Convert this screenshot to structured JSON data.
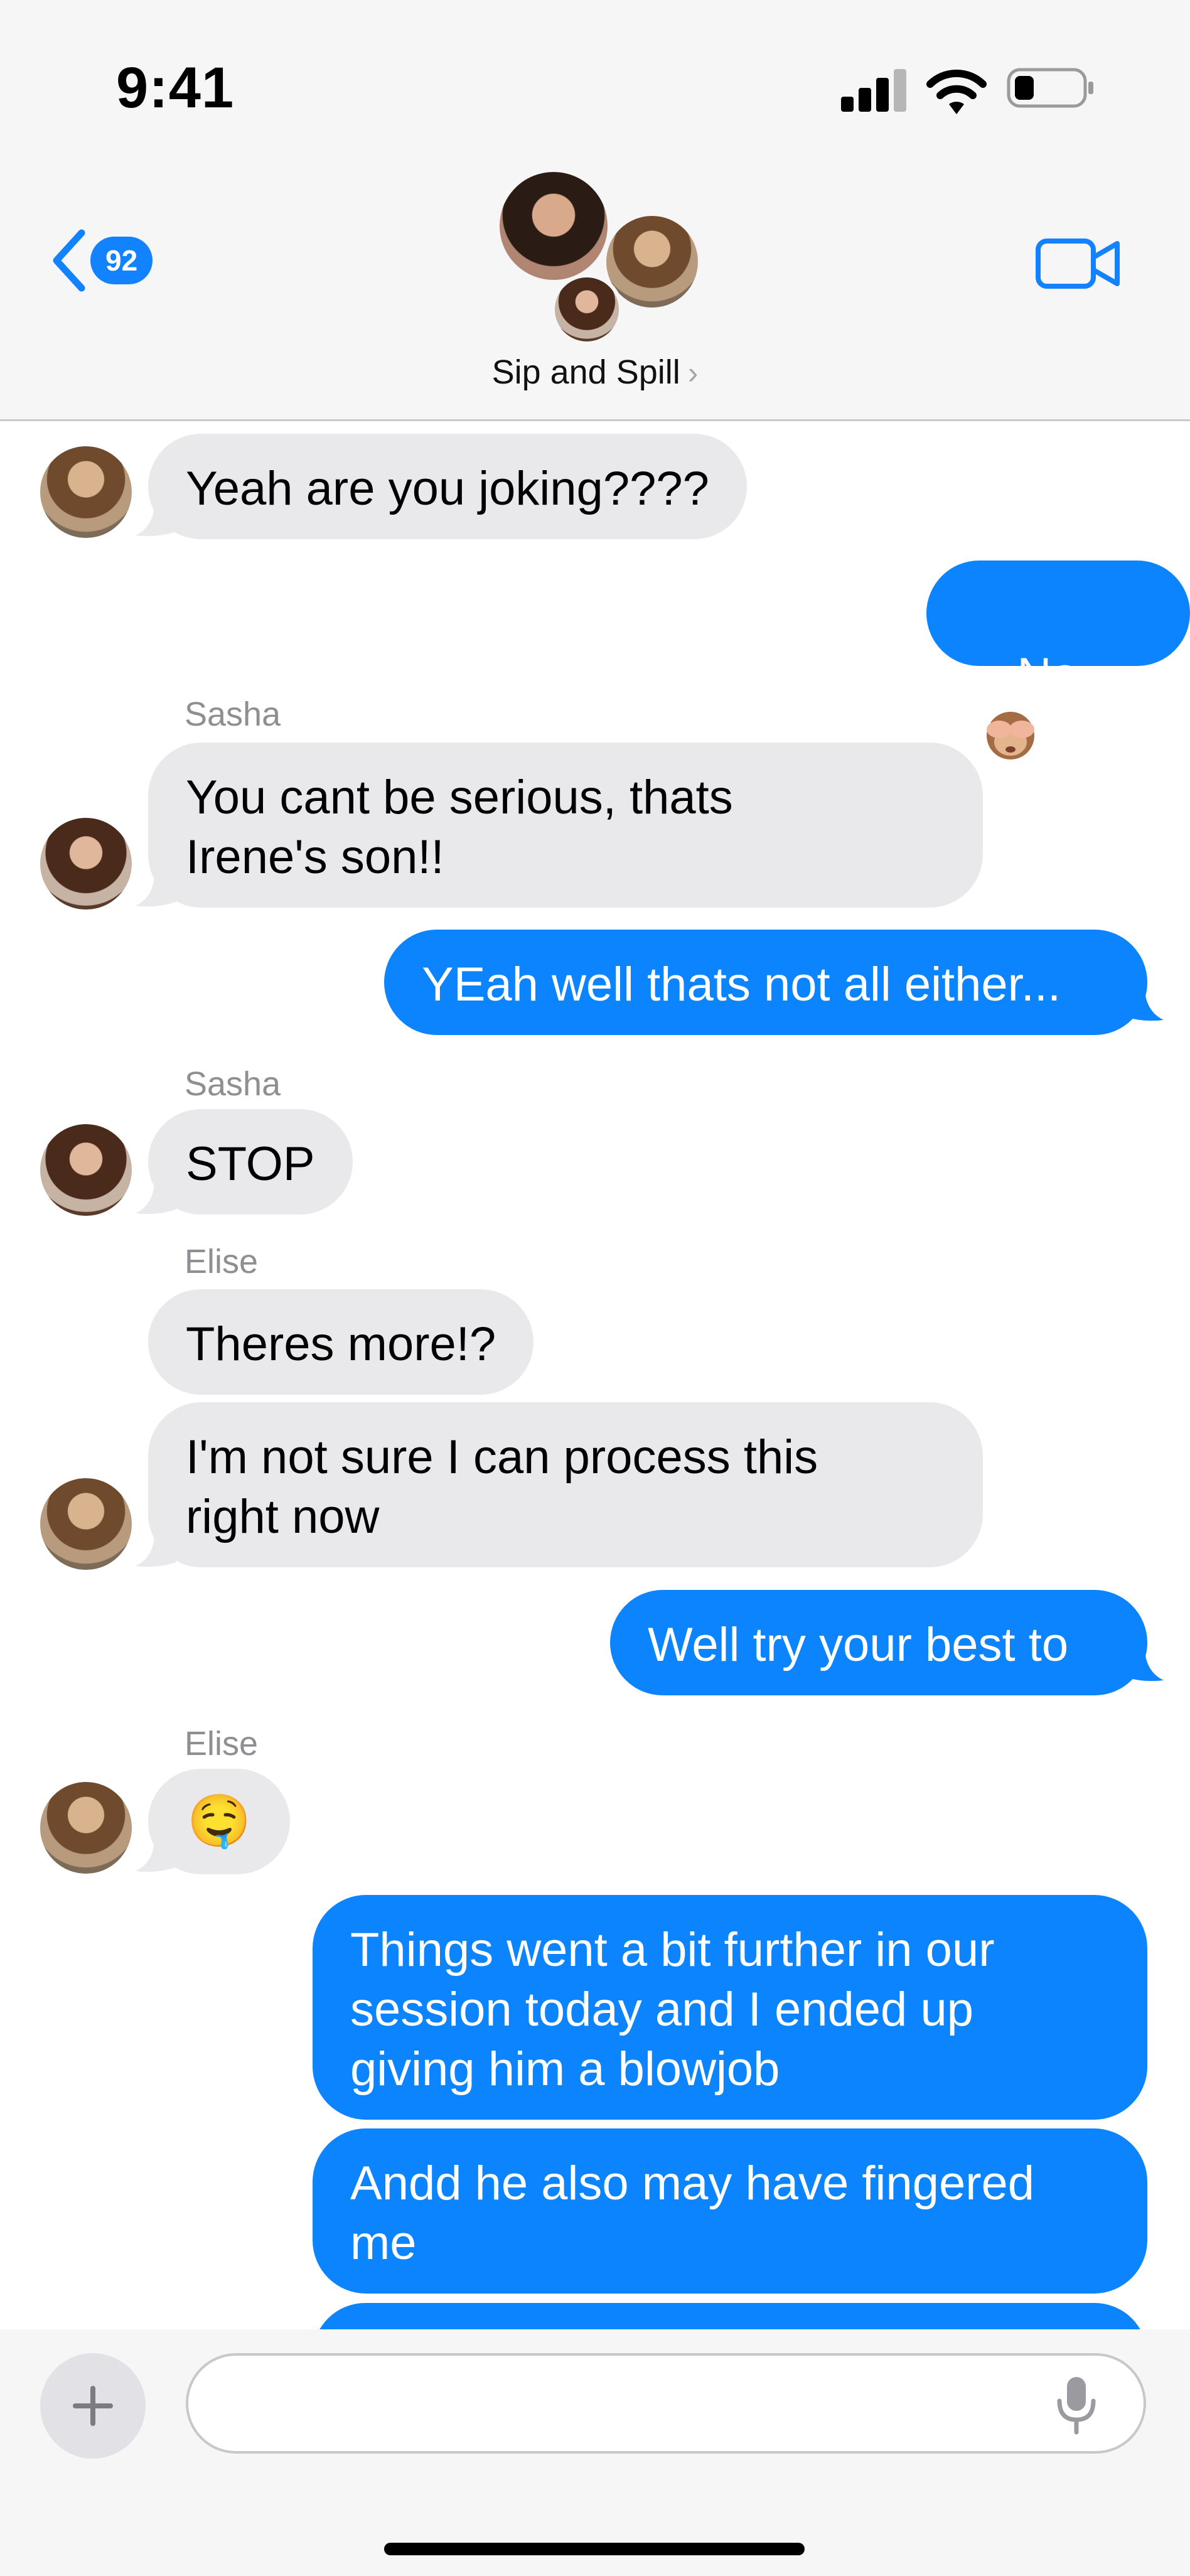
{
  "status_bar": {
    "time": "9:41"
  },
  "header": {
    "back_badge": "92",
    "group_name": "Sip and Spill"
  },
  "messages": [
    {
      "direction": "incoming",
      "sender": "",
      "text": "Yeah are you joking????"
    },
    {
      "direction": "outgoing",
      "text": "No",
      "emoji_icon": "see-no-evil-monkey-icon"
    },
    {
      "direction": "incoming",
      "sender": "Sasha",
      "text": "You cant be serious, thats\nIrene's son!!"
    },
    {
      "direction": "outgoing",
      "text": "YEah well thats not all either..."
    },
    {
      "direction": "incoming",
      "sender": "Sasha",
      "text": "STOP"
    },
    {
      "direction": "incoming",
      "sender": "Elise",
      "text": "Theres more!?"
    },
    {
      "direction": "incoming",
      "sender": "",
      "text": "I'm not sure I can process this\nright now"
    },
    {
      "direction": "outgoing",
      "text": "Well try your best to"
    },
    {
      "direction": "incoming",
      "sender": "Elise",
      "text": "🤤"
    },
    {
      "direction": "outgoing",
      "text": "Things went a bit further in our\nsession today and I ended up\ngiving him a blowjob"
    },
    {
      "direction": "outgoing",
      "text": "Andd he also may have fingered\nme"
    },
    {
      "direction": "outgoing",
      "text": ""
    }
  ],
  "composer": {
    "placeholder": ""
  },
  "colors": {
    "accent": "#0b84fe",
    "incoming_bubble": "#e9e9eb",
    "outgoing_bubble": "#0b84fe",
    "meta_gray": "#8e8e93"
  }
}
